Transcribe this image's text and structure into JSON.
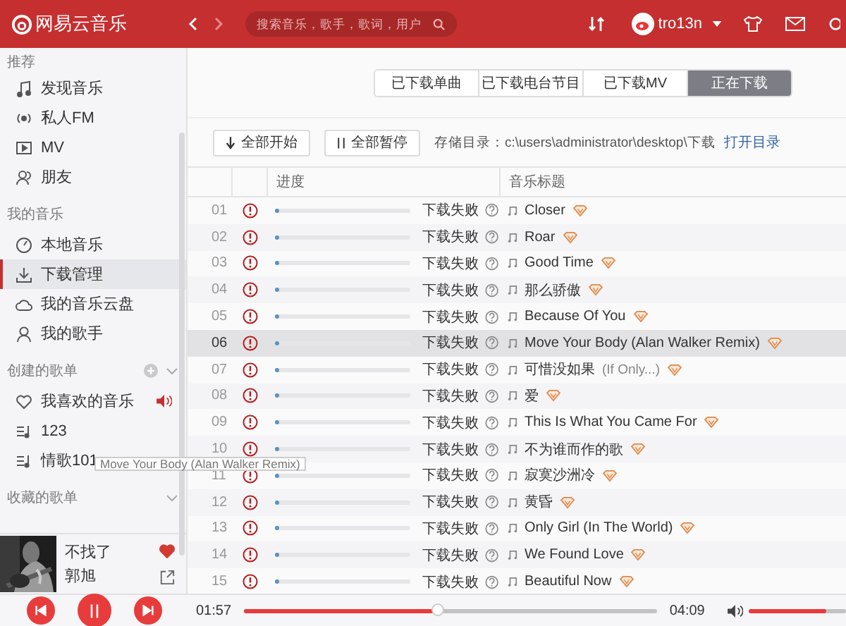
{
  "app": {
    "logo": "网易云音乐",
    "search": {
      "placeholder": "搜索音乐，歌手，歌词，用户"
    },
    "user": "tro13n"
  },
  "sidebar": {
    "sections": [
      {
        "heading": "推荐",
        "items": [
          {
            "label": "发现音乐",
            "selected": false
          },
          {
            "label": "私人FM",
            "selected": false
          },
          {
            "label": "MV",
            "selected": false
          },
          {
            "label": "朋友",
            "selected": false
          }
        ]
      },
      {
        "heading": "我的音乐",
        "items": [
          {
            "label": "本地音乐",
            "selected": false
          },
          {
            "label": "下载管理",
            "selected": true
          },
          {
            "label": "我的音乐云盘",
            "selected": false
          },
          {
            "label": "我的歌手",
            "selected": false
          }
        ]
      },
      {
        "heading": "创建的歌单",
        "add": true,
        "items": [
          {
            "label": "我喜欢的音乐",
            "selected": false,
            "playing": true
          },
          {
            "label": "123",
            "selected": false,
            "playing": false
          },
          {
            "label": "情歌101",
            "selected": false,
            "playing": false
          }
        ]
      },
      {
        "heading": "收藏的歌单"
      }
    ],
    "now_playing": {
      "title": "不找了",
      "artist": "郭旭",
      "liked": true
    }
  },
  "tooltip": "Move Your Body (Alan Walker Remix)",
  "tabs": [
    {
      "label": "已下载单曲",
      "selected": false
    },
    {
      "label": "已下载电台节目",
      "selected": false
    },
    {
      "label": "已下载MV",
      "selected": false
    },
    {
      "label": "正在下载",
      "selected": true
    }
  ],
  "toolbar": {
    "start_all": "全部开始",
    "pause_all": "全部暂停",
    "path_label": "存储目录：c:\\users\\administrator\\desktop\\下载",
    "open_folder": "打开目录"
  },
  "table": {
    "columns": [
      "进度",
      "音乐标题"
    ],
    "rows": [
      {
        "index": "01",
        "level": 0.03,
        "status": "下载失败",
        "title": "Closer",
        "selected": false
      },
      {
        "index": "02",
        "level": 0.03,
        "status": "下载失败",
        "title": "Roar",
        "selected": false
      },
      {
        "index": "03",
        "level": 0.03,
        "status": "下载失败",
        "title": "Good Time",
        "selected": false
      },
      {
        "index": "04",
        "level": 0.03,
        "status": "下载失败",
        "title": "那么骄傲",
        "selected": false
      },
      {
        "index": "05",
        "level": 0.03,
        "status": "下载失败",
        "title": "Because Of You",
        "selected": false
      },
      {
        "index": "06",
        "level": 0.03,
        "status": "下载失败",
        "title": "Move Your Body (Alan Walker Remix)",
        "selected": true
      },
      {
        "index": "07",
        "level": 0.03,
        "status": "下载失败",
        "title": "可惜没如果",
        "subtitle": "(If Only...)",
        "selected": false
      },
      {
        "index": "08",
        "level": 0.03,
        "status": "下载失败",
        "title": "爱",
        "selected": false
      },
      {
        "index": "09",
        "level": 0.03,
        "status": "下载失败",
        "title": "This Is What You Came For",
        "selected": false
      },
      {
        "index": "10",
        "level": 0.03,
        "status": "下载失败",
        "title": "不为谁而作的歌",
        "selected": false
      },
      {
        "index": "11",
        "level": 0.03,
        "status": "下载失败",
        "title": "寂寞沙洲冷",
        "selected": false
      },
      {
        "index": "12",
        "level": 0.03,
        "status": "下载失败",
        "title": "黄昏",
        "selected": false
      },
      {
        "index": "13",
        "level": 0.03,
        "status": "下载失败",
        "title": "Only Girl (In The World)",
        "selected": false
      },
      {
        "index": "14",
        "level": 0.03,
        "status": "下载失败",
        "title": "We Found Love",
        "selected": false
      },
      {
        "index": "15",
        "level": 0.03,
        "status": "下载失败",
        "title": "Beautiful Now",
        "selected": false
      }
    ]
  },
  "player": {
    "elapsed": "01:57",
    "duration": "04:09",
    "level": 0.47,
    "volume": {
      "level": 0.8
    }
  }
}
